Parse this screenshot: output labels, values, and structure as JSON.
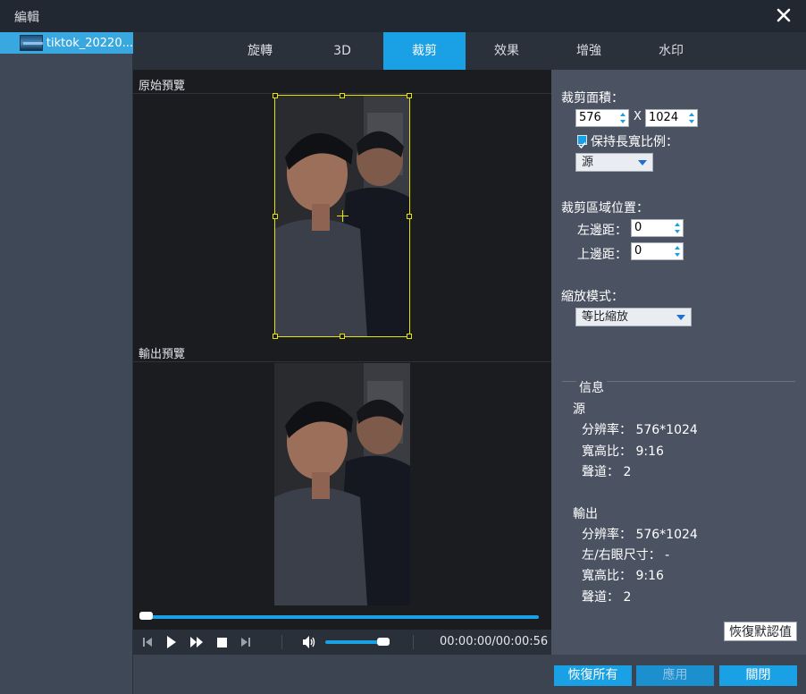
{
  "window": {
    "title": "編輯"
  },
  "files": [
    {
      "name": "tiktok_20220..."
    }
  ],
  "tabs": [
    {
      "label": "旋轉",
      "active": false
    },
    {
      "label": "3D",
      "active": false
    },
    {
      "label": "裁剪",
      "active": true
    },
    {
      "label": "效果",
      "active": false
    },
    {
      "label": "增強",
      "active": false
    },
    {
      "label": "水印",
      "active": false
    }
  ],
  "preview": {
    "original_label": "原始預覽",
    "output_label": "輸出預覽"
  },
  "playback": {
    "time": "00:00:00/00:00:56",
    "progress": 0.0,
    "volume": 0.85
  },
  "crop": {
    "area_label": "裁剪面積：",
    "width": "576",
    "x_sep": "X",
    "height": "1024",
    "keep_ratio_label": "保持長寬比例：",
    "keep_ratio_checked": true,
    "ratio_value": "源",
    "position_label": "裁剪區域位置：",
    "left_label": "左邊距：",
    "left_value": "0",
    "top_label": "上邊距：",
    "top_value": "0",
    "zoom_label": "縮放模式：",
    "zoom_value": "等比縮放"
  },
  "info": {
    "title": "信息",
    "source_title": "源",
    "source_resolution": "分辨率： 576*1024",
    "source_aspect": "寬高比： 9:16",
    "source_channels": "聲道： 2",
    "output_title": "輸出",
    "output_resolution": "分辨率： 576*1024",
    "output_eye": "左/右眼尺寸： -",
    "output_aspect": "寬高比： 9:16",
    "output_channels": "聲道： 2"
  },
  "buttons": {
    "restore_default": "恢復默認值",
    "restore_all": "恢復所有",
    "apply": "應用",
    "close": "關閉"
  },
  "colors": {
    "accent": "#1aa0e4",
    "crop_frame": "#e4e400",
    "panel": "#4b5363"
  }
}
